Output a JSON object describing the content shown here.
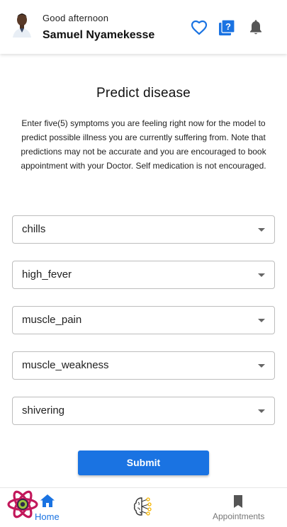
{
  "header": {
    "greeting": "Good afternoon",
    "user_name": "Samuel Nyamekesse",
    "icons": [
      "avatar",
      "heart-outline-icon",
      "help-box-icon",
      "bell-icon"
    ],
    "accent_color": "#1a73e2"
  },
  "main": {
    "title": "Predict disease",
    "description": "Enter five(5) symptoms you are feeling right now for the model to predict possible illness you are currently suffering from. Note that predictions may not be accurate and you are encouraged to book appointment with your Doctor. Self medication is not encouraged.",
    "symptoms": [
      {
        "value": "chills"
      },
      {
        "value": "high_fever"
      },
      {
        "value": "muscle_pain"
      },
      {
        "value": "muscle_weakness"
      },
      {
        "value": "shivering"
      }
    ],
    "submit_label": "Submit"
  },
  "bottom_nav": {
    "items": [
      {
        "label": "Home",
        "icon": "home-icon",
        "active": true
      },
      {
        "label": "",
        "icon": "ai-brain-icon",
        "active": false
      },
      {
        "label": "Appointments",
        "icon": "bookmark-icon",
        "active": false
      }
    ]
  }
}
